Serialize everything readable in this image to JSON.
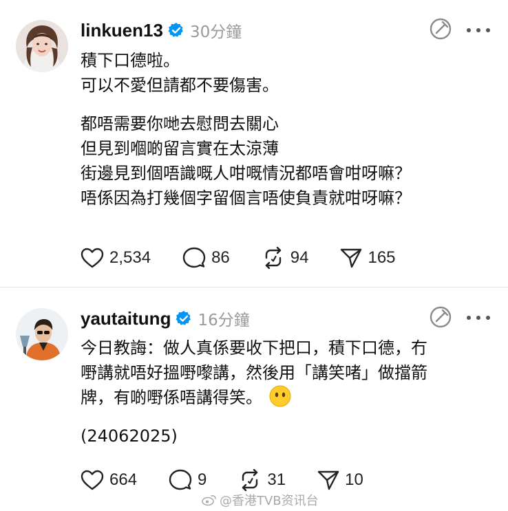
{
  "posts": [
    {
      "username": "linkuen13",
      "time": "30分鐘",
      "body_lines": [
        "積下口德啦。",
        "可以不愛但請都不要傷害。",
        "",
        "都唔需要你哋去慰問去關心",
        "但見到嗰啲留言實在太涼薄",
        "街邊見到個唔識嘅人咁嘅情況都唔會咁呀嘛？",
        "唔係因為打幾個字留個言唔使負責就咁呀嘛？"
      ],
      "likes": "2,534",
      "replies": "86",
      "reposts": "94",
      "shares": "165"
    },
    {
      "username": "yautaitung",
      "time": "16分鐘",
      "body_lines": [
        "今日教誨：做人真係要收下把口，積下口德，冇",
        "嘢講就唔好搵嘢嚟講，然後用「講笑啫」做擋箭",
        "牌，有啲嘢係唔講得笑。",
        "",
        "(24062025)"
      ],
      "emoji_name": "face-without-mouth-emoji",
      "likes": "664",
      "replies": "9",
      "reposts": "31",
      "shares": "10"
    }
  ],
  "watermark": "@香港TVB资讯台",
  "icons": {
    "verified": "verified-badge-icon",
    "translate": "translate-icon",
    "more": "more-icon",
    "like": "heart-icon",
    "reply": "comment-icon",
    "repost": "repost-icon",
    "share": "send-icon"
  },
  "colors": {
    "text": "#101010",
    "muted": "#9a9a9a",
    "verified_blue": "#0095f6"
  }
}
